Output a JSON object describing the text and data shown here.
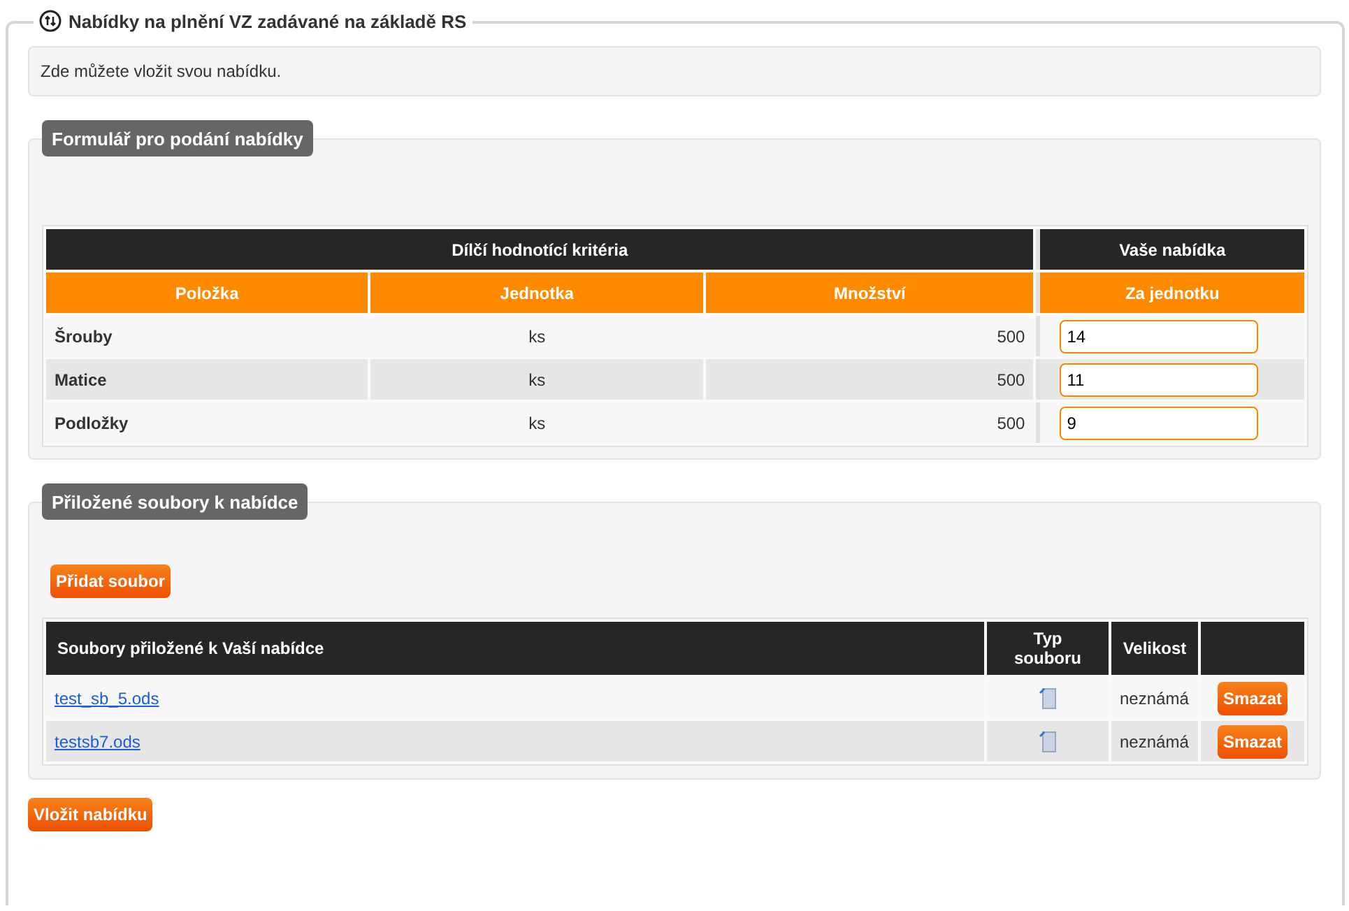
{
  "title": "Nabídky na plnění VZ zadávané na základě RS",
  "info": "Zde můžete vložit svou nabídku.",
  "offer_form": {
    "legend": "Formulář pro podání nabídky",
    "group_headers": [
      "Dílčí hodnotící kritéria",
      "Vaše nabídka"
    ],
    "columns": [
      "Položka",
      "Jednotka",
      "Množství",
      "Za jednotku"
    ],
    "rows": [
      {
        "item": "Šrouby",
        "unit": "ks",
        "quantity": "500",
        "price": "14"
      },
      {
        "item": "Matice",
        "unit": "ks",
        "quantity": "500",
        "price": "11"
      },
      {
        "item": "Podložky",
        "unit": "ks",
        "quantity": "500",
        "price": "9"
      }
    ]
  },
  "attachments": {
    "legend": "Přiložené soubory k nabídce",
    "add_button": "Přidat soubor",
    "columns": [
      "Soubory přiložené k Vaší nabídce",
      "Typ souboru",
      "Velikost"
    ],
    "rows": [
      {
        "name": "test_sb_5.ods",
        "size": "neznámá",
        "delete": "Smazat"
      },
      {
        "name": "testsb7.ods",
        "size": "neznámá",
        "delete": "Smazat"
      }
    ]
  },
  "submit_button": "Vložit nabídku"
}
